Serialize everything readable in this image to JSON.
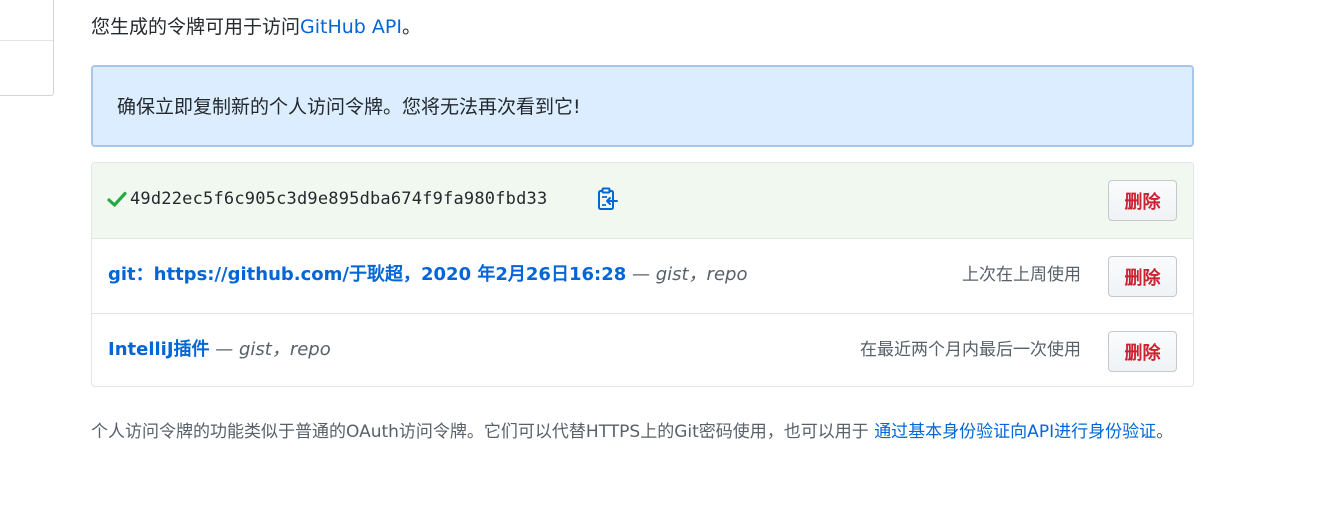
{
  "intro": {
    "prefix": "您生成的令牌可用于访问",
    "link": "GitHub API",
    "suffix": "。"
  },
  "flash": {
    "message": "确保立即复制新的个人访问令牌。您将无法再次看到它!"
  },
  "tokens": [
    {
      "value": "49d22ec5f6c905c3d9e895dba674f9fa980fbd33",
      "delete_label": "删除"
    },
    {
      "name": "git：https://github.com/于耿超，2020 年2月26日16:28",
      "scopes": " — gist，repo",
      "last_used": "上次在上周使用",
      "delete_label": "删除"
    },
    {
      "name": "IntelliJ插件",
      "scopes": " — gist，repo",
      "last_used": "在最近两个月内最后一次使用",
      "delete_label": "删除"
    }
  ],
  "footnote": {
    "text": "个人访问令牌的功能类似于普通的OAuth访问令牌。它们可以代替HTTPS上的Git密码使用，也可以用于 ",
    "link": "通过基本身份验证向API进行身份验证",
    "suffix": "。"
  },
  "colors": {
    "link": "#0366d6",
    "danger": "#cb2431",
    "success": "#28a745",
    "flash_bg": "#dbedff"
  }
}
